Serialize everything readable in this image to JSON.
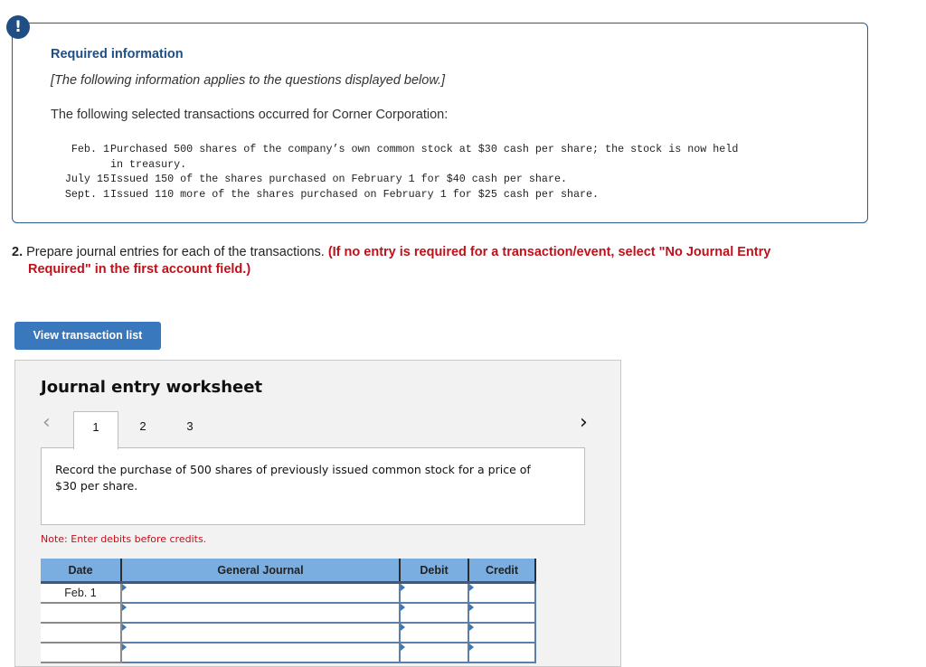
{
  "info": {
    "badge": "!",
    "title": "Required information",
    "subtitle": "[The following information applies to the questions displayed below.]",
    "intro": "The following selected transactions occurred for Corner Corporation:",
    "transactions": [
      {
        "date": "Feb. 1",
        "text": "Purchased 500 shares of the company’s own common stock at $30 cash per share; the stock is now held"
      },
      {
        "date": "",
        "text": "in treasury."
      },
      {
        "date": "July 15",
        "text": "Issued 150 of the shares purchased on February 1 for $40 cash per share."
      },
      {
        "date": "Sept. 1",
        "text": "Issued 110 more of the shares purchased on February 1 for $25 cash per share."
      }
    ]
  },
  "question": {
    "number": "2.",
    "text": "Prepare journal entries for each of the transactions.",
    "hint_line1": "(If no entry is required for a transaction/event, select \"No Journal Entry",
    "hint_line2": "Required\" in the first account field.)"
  },
  "view_button": "View transaction list",
  "worksheet": {
    "title": "Journal entry worksheet",
    "prev_icon": "‹",
    "next_icon": "›",
    "tabs": [
      "1",
      "2",
      "3"
    ],
    "active_tab": "1",
    "description": "Record the purchase of 500 shares of previously issued common stock for a price of $30 per share.",
    "note": "Note: Enter debits before credits.",
    "table": {
      "headers": [
        "Date",
        "General Journal",
        "Debit",
        "Credit"
      ],
      "rows": [
        {
          "date": "Feb. 1",
          "account": "",
          "debit": "",
          "credit": ""
        },
        {
          "date": "",
          "account": "",
          "debit": "",
          "credit": ""
        },
        {
          "date": "",
          "account": "",
          "debit": "",
          "credit": ""
        },
        {
          "date": "",
          "account": "",
          "debit": "",
          "credit": ""
        }
      ]
    }
  }
}
